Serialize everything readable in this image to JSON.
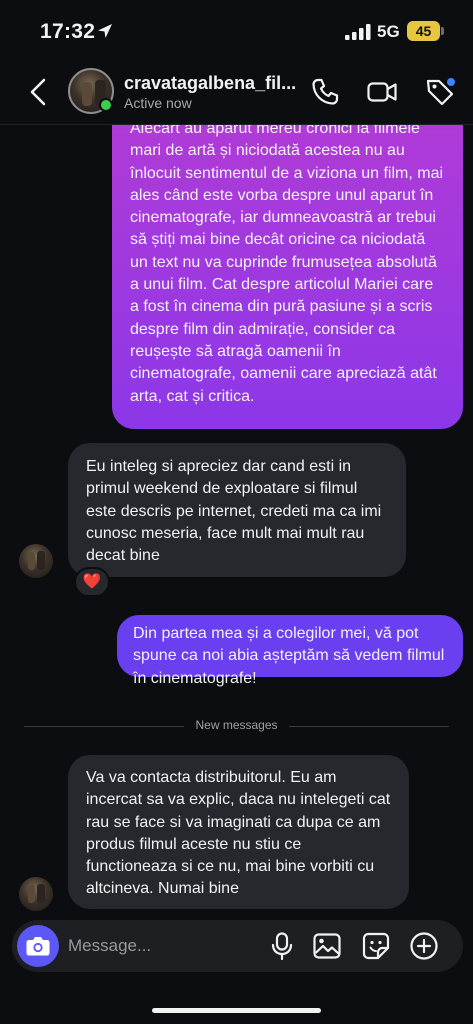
{
  "status_bar": {
    "time": "17:32",
    "network": "5G",
    "battery": "45"
  },
  "header": {
    "name": "cravatagalbena_fil...",
    "status": "Active now"
  },
  "messages": [
    {
      "direction": "outgoing",
      "text": "Alecart au aparut mereu cronici la filmele mari de artă și niciodată acestea nu au înlocuit sentimentul de a viziona un film, mai ales când este vorba despre unul aparut în cinematografe, iar dumneavoastră ar trebui să știți mai bine decât oricine ca niciodată un text nu va cuprinde frumusețea absolută a unui film. Cat despre articolul Mariei care a fost în cinema din pură pasiune și a scris despre film din admirație, consider ca reușește să atragă oamenii în cinematografe, oamenii care apreciază atât arta, cat și critica."
    },
    {
      "direction": "incoming",
      "text": "Eu inteleg si apreciez dar cand esti in primul weekend de exploatare si filmul este descris pe internet, credeti ma ca imi cunosc meseria, face mult mai mult rau decat bine",
      "reaction": "❤️"
    },
    {
      "direction": "outgoing",
      "text": "Din partea mea și a colegilor mei, vă pot spune ca noi abia așteptăm să vedem filmul în cinematografe!"
    },
    {
      "direction": "incoming",
      "text": "Va va contacta distribuitorul. Eu am incercat sa va explic, daca nu intelegeti cat rau se face si va imaginati ca dupa ce am produs filmul aceste nu stiu ce functioneaza si ce nu, mai bine vorbiti cu altcineva.  Numai bine"
    }
  ],
  "divider": {
    "label": "New messages"
  },
  "composer": {
    "placeholder": "Message..."
  },
  "colors": {
    "background": "#0b0d10",
    "incoming_bubble": "#26282d",
    "outgoing_bubble_gradient": [
      "#b23bd6",
      "#8c37e8"
    ],
    "outgoing_bubble_solid": "#6a3ff0",
    "camera_button": "#5b58f5",
    "online": "#3ccf4e",
    "notification_dot": "#3f84ff",
    "battery": "#e8c640"
  },
  "icons": {
    "status_location": "location-arrow-icon",
    "back": "chevron-left-icon",
    "call": "phone-icon",
    "video": "video-camera-icon",
    "tag": "tag-icon",
    "camera": "camera-icon",
    "mic": "microphone-icon",
    "gallery": "image-icon",
    "sticker": "sticker-icon",
    "plus": "plus-circle-icon"
  }
}
